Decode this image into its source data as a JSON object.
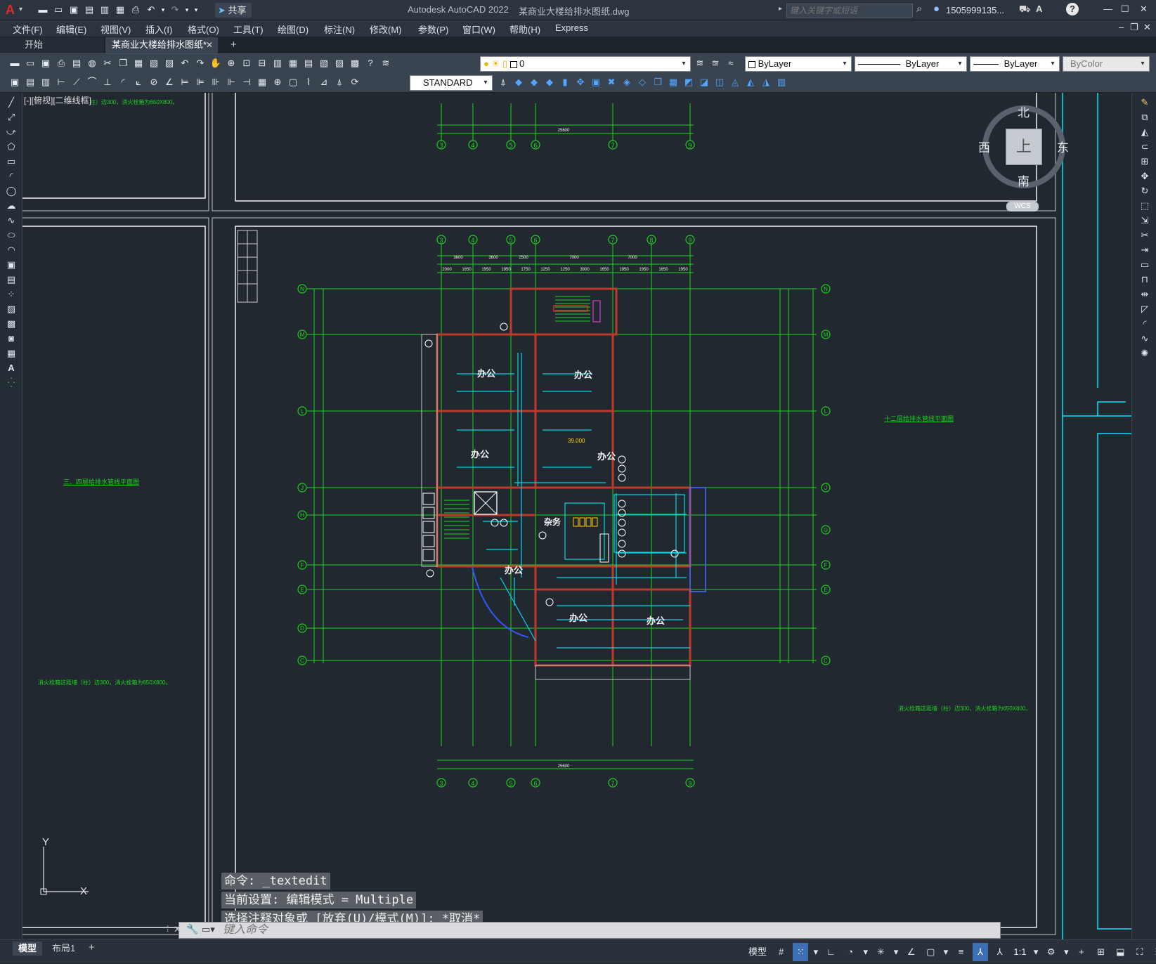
{
  "app": {
    "logo_letter": "A",
    "title": "Autodesk AutoCAD 2022",
    "filename": "某商业大楼给排水图纸.dwg",
    "share_label": "共享",
    "search_placeholder": "键入关键字或短语",
    "user": "1505999135...",
    "window_buttons": [
      "—",
      "☐",
      "✕"
    ],
    "doc_window_buttons": [
      "–",
      "❐",
      "✕"
    ]
  },
  "menu": [
    "文件(F)",
    "编辑(E)",
    "视图(V)",
    "插入(I)",
    "格式(O)",
    "工具(T)",
    "绘图(D)",
    "标注(N)",
    "修改(M)",
    "参数(P)",
    "窗口(W)",
    "帮助(H)",
    "Express"
  ],
  "tabs": [
    {
      "label": "开始",
      "active": false
    },
    {
      "label": "某商业大楼给排水图纸*",
      "active": true
    }
  ],
  "tab_close": "✕",
  "tab_add": "+",
  "toolbar": {
    "layer_value": "0",
    "color_value": "ByLayer",
    "linetype_value": "ByLayer",
    "lineweight_value": "ByLayer",
    "plotstyle_value": "ByColor",
    "textstyle_value": "STANDARD"
  },
  "viewport_label": "[-][俯视][二维线框]",
  "viewcube": {
    "north": "北",
    "south": "南",
    "west": "西",
    "east": "东",
    "face": "上",
    "wcs": "WCS"
  },
  "drawing": {
    "grid_bottom": [
      "3",
      "4",
      "5",
      "6",
      "7",
      "9"
    ],
    "grid_top": [
      "3",
      "4",
      "5",
      "6",
      "7",
      "8",
      "9"
    ],
    "grid_left": [
      "N",
      "M",
      "L",
      "J",
      "H",
      "F",
      "E",
      "D",
      "C"
    ],
    "grid_right": [
      "N",
      "M",
      "L",
      "J",
      "G",
      "F",
      "E",
      "C"
    ],
    "room_office": "办公",
    "room_misc": "杂务",
    "elevation": "39.000",
    "note_text": "消火栓箱这距墙（柱）边300，消火栓箱为650X800。",
    "title_left": "三、四层给排水管线平面图",
    "title_right": "十二层给排水管线平面图",
    "dim_total": "25600",
    "dims_top": [
      "3600",
      "3600",
      "2500",
      "7000",
      "7000"
    ],
    "dims_top_detail": [
      "2000",
      "1650",
      "1950",
      "1950",
      "1750",
      "1250",
      "1250",
      "3900",
      "1650",
      "1950",
      "1950",
      "1650",
      "1950"
    ]
  },
  "ucs": {
    "x": "X",
    "y": "Y"
  },
  "command": {
    "history": [
      "命令: _textedit",
      "当前设置: 编辑模式 = Multiple",
      "选择注释对象或 [放弃(U)/模式(M)]: *取消*"
    ],
    "placeholder": "键入命令"
  },
  "layout_tabs": [
    "模型",
    "布局1"
  ],
  "layout_add": "+",
  "status": {
    "model": "模型",
    "scale": "1:1"
  }
}
